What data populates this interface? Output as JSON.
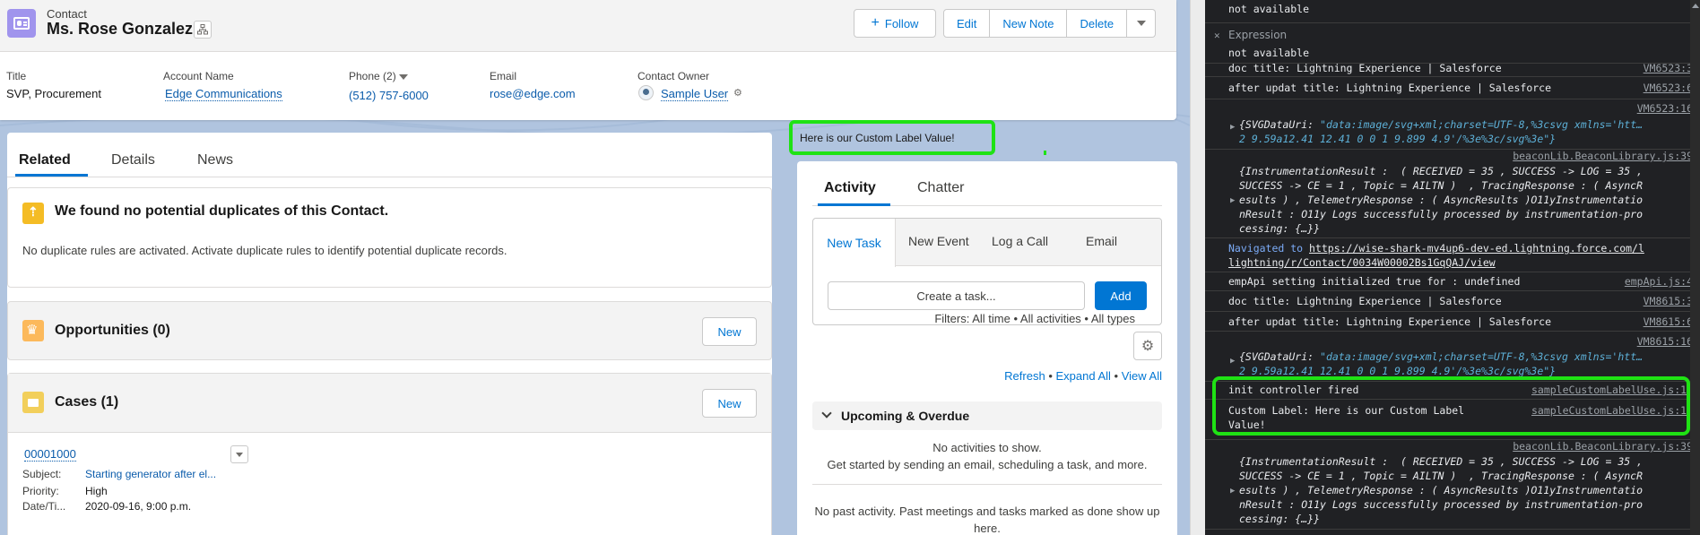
{
  "record": {
    "object_type": "Contact",
    "name": "Ms. Rose Gonzalez",
    "actions": {
      "follow": "Follow",
      "edit": "Edit",
      "new_note": "New Note",
      "delete": "Delete"
    },
    "highlights": {
      "title_label": "Title",
      "title_value": "SVP, Procurement",
      "account_label": "Account Name",
      "account_value": "Edge Communications",
      "phone_label": "Phone (2)",
      "phone_value": "(512) 757-6000",
      "email_label": "Email",
      "email_value": "rose@edge.com",
      "owner_label": "Contact Owner",
      "owner_value": "Sample User"
    }
  },
  "left_tabs": {
    "related": "Related",
    "details": "Details",
    "news": "News"
  },
  "duplicates": {
    "title": "We found no potential duplicates of this Contact.",
    "text": "No duplicate rules are activated. Activate duplicate rules to identify potential duplicate records."
  },
  "opportunities": {
    "title": "Opportunities (0)",
    "new": "New"
  },
  "cases": {
    "title": "Cases (1)",
    "new": "New",
    "number": "00001000",
    "subject_label": "Subject:",
    "subject_value": "Starting generator after el...",
    "priority_label": "Priority:",
    "priority_value": "High",
    "date_label": "Date/Ti...",
    "date_value": "2020-09-16, 9:00 p.m."
  },
  "custom_label": "Here is our Custom Label Value!",
  "activity": {
    "tab_activity": "Activity",
    "tab_chatter": "Chatter",
    "composer_tabs": {
      "task": "New Task",
      "event": "New Event",
      "call": "Log a Call",
      "email": "Email"
    },
    "task_placeholder": "Create a task...",
    "add": "Add",
    "filters": "Filters: All time • All activities • All types",
    "refresh": "Refresh",
    "expand_all": "Expand All",
    "view_all": "View All",
    "upcoming": "Upcoming & Overdue",
    "no_activities_1": "No activities to show.",
    "no_activities_2": "Get started by sending an email, scheduling a task, and more.",
    "no_past_1": "No past activity. Past meetings and tasks marked as done show up",
    "no_past_2": "here."
  },
  "console": {
    "not_available_1": "not available",
    "expression": "Expression",
    "not_available_2": "not available",
    "lines": {
      "doc_title_1": "doc title: Lightning Experience | Salesforce",
      "doc_title_1_src": "VM6523:3",
      "after_title_1": "after updat title: Lightning Experience | Salesforce",
      "after_title_1_src": "VM6523:6",
      "svg_1_src": "VM6523:16",
      "svg_1_a": "{SVGDataUri: ",
      "svg_1_b": "\"data:image/svg+xml;charset=UTF-8,%3csvg xmlns='htt…",
      "svg_1_c": "2 9.59a12.41 12.41 0 0 1 9.899 4.9'/%3e%3c/svg%3e\"}",
      "beacon_1_src": "beaconLib.BeaconLibrary.js:39",
      "beacon_1_l1": "{InstrumentationResult :  ( RECEIVED = 35 , SUCCESS -> LOG = 35 ,",
      "beacon_1_l2": "SUCCESS -> CE = 1 , Topic = AILTN )  , TracingResponse : ( AsyncR",
      "beacon_1_l3": "esults ) , TelemetryResponse : ( AsyncResults )O11yInstrumentatio",
      "beacon_1_l4": "nResult : O11y Logs successfully processed by instrumentation-pro",
      "beacon_1_l5": "cessing: {…}}",
      "nav_prefix": "Navigated to ",
      "nav_url_1": "https://wise-shark-mv4up6-dev-ed.lightning.force.com/l",
      "nav_url_2": "lightning/r/Contact/0034W00002Bs1GqQAJ/view",
      "empapi": "empApi setting initialized true for : undefined",
      "empapi_src": "empApi.js:4",
      "doc_title_2": "doc title: Lightning Experience | Salesforce",
      "doc_title_2_src": "VM8615:3",
      "after_title_2": "after updat title: Lightning Experience | Salesforce",
      "after_title_2_src": "VM8615:6",
      "svg_2_src": "VM8615:16",
      "init": "init controller fired",
      "init_src": "sampleCustomLabelUse.js:11",
      "custom_1": "Custom Label: Here is our Custom Label",
      "custom_2": "Value!",
      "custom_src": "sampleCustomLabelUse.js:12",
      "beacon_2_src": "beaconLib.BeaconLibrary.js:39"
    }
  }
}
